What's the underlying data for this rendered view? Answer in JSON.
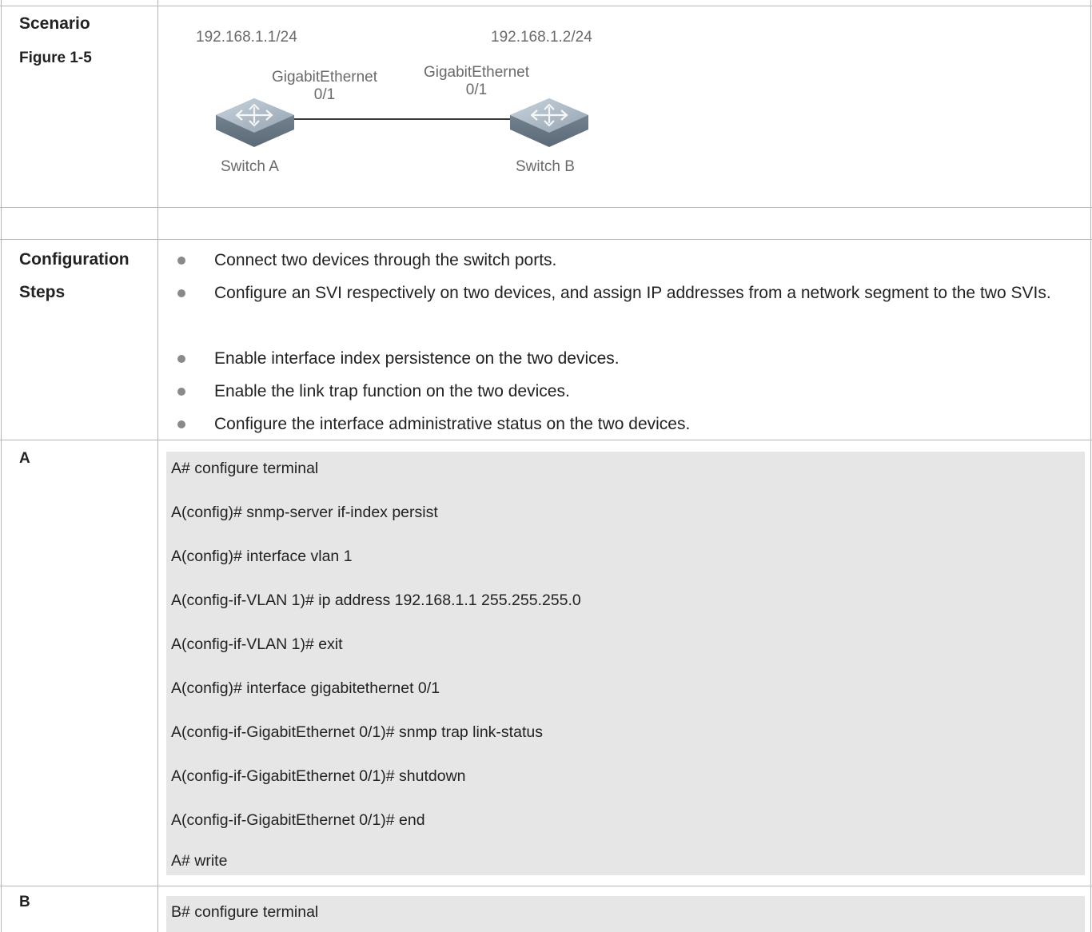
{
  "scenario": {
    "label_line1": "Scenario",
    "label_line2": "Figure 1-5",
    "diagram": {
      "switch_a": {
        "ip": "192.168.1.1/24",
        "port_line1": "GigabitEthernet",
        "port_line2": "0/1",
        "name": "Switch A"
      },
      "switch_b": {
        "ip": "192.168.1.2/24",
        "port_line1": "GigabitEthernet",
        "port_line2": "0/1",
        "name": "Switch B"
      }
    }
  },
  "config_steps": {
    "label_line1": "Configuration",
    "label_line2": "Steps",
    "items": [
      "Connect two devices through the switch ports.",
      "Configure an SVI respectively on two devices, and assign IP addresses from a network segment to the two SVIs.",
      "Enable interface index persistence on the two devices.",
      "Enable the link trap function on the two devices.",
      "Configure the interface administrative status on the two devices."
    ]
  },
  "device_a": {
    "label": "A",
    "commands": [
      "A# configure terminal",
      "A(config)# snmp-server if-index persist",
      "A(config)# interface vlan 1",
      "A(config-if-VLAN 1)# ip address 192.168.1.1 255.255.255.0",
      "A(config-if-VLAN 1)# exit",
      "A(config)# interface gigabitethernet 0/1",
      "A(config-if-GigabitEthernet 0/1)# snmp trap link-status",
      "A(config-if-GigabitEthernet 0/1)# shutdown",
      "A(config-if-GigabitEthernet 0/1)# end",
      "A# write"
    ]
  },
  "device_b": {
    "label": "B",
    "commands": [
      "B# configure terminal"
    ]
  }
}
